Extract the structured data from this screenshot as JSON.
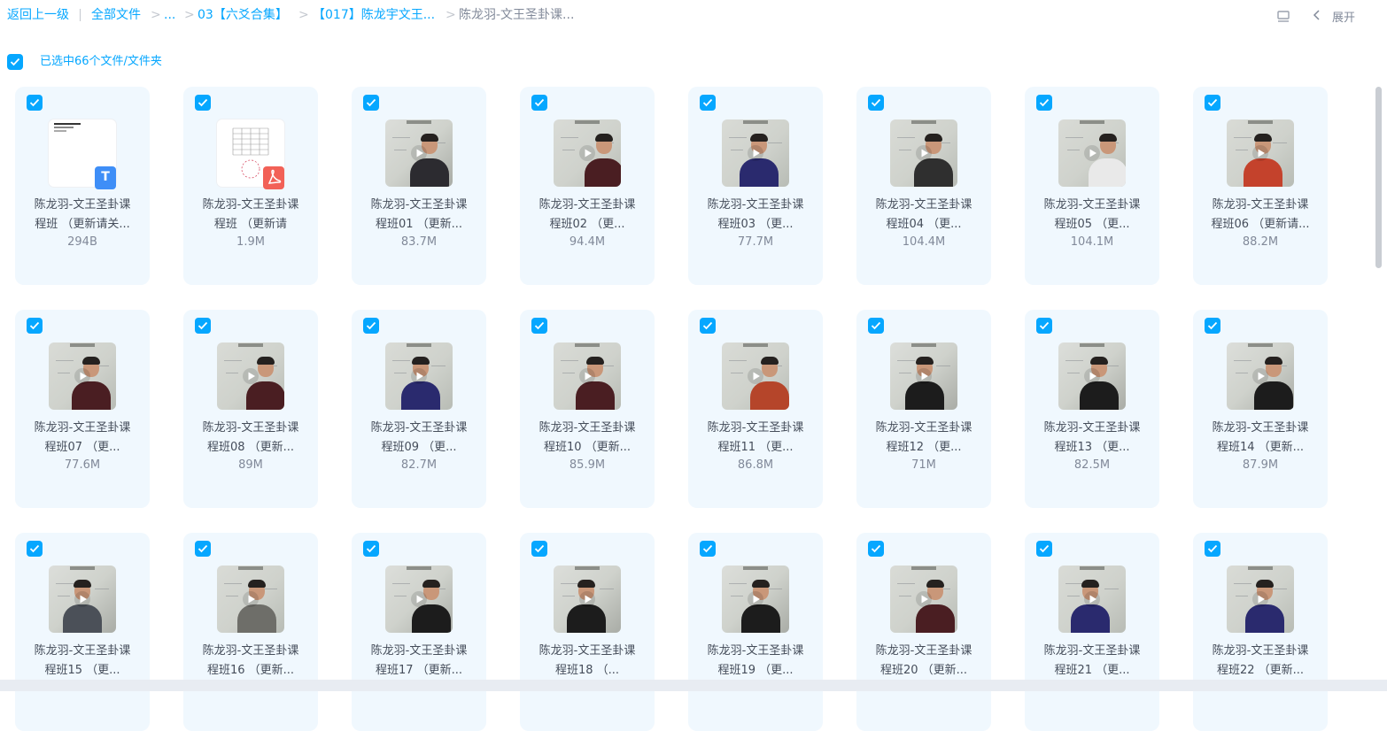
{
  "breadcrumb": {
    "back": "返回上一级",
    "all_files": "全部文件",
    "ellipsis": "...",
    "level1": "03【六爻合集】",
    "level2": "【017】陈龙宇文王...",
    "current": "陈龙羽-文王圣卦课..."
  },
  "toolbar": {
    "collapse_label": "展开"
  },
  "selection": {
    "label": "已选中66个文件/文件夹"
  },
  "colors": {
    "accent": "#06a7ff",
    "card_bg": "#f0f8fe",
    "text": "#454d5a",
    "muted": "#818999"
  },
  "files": [
    {
      "line1": "陈龙羽-文王圣卦课",
      "line2": "程班 （更新请关...",
      "size": "294B",
      "kind": "doc",
      "badge": "T"
    },
    {
      "line1": "陈龙羽-文王圣卦课",
      "line2": "程班 （更新请",
      "size": "1.9M",
      "kind": "pdf"
    },
    {
      "line1": "陈龙羽-文王圣卦课",
      "line2": "程班01 （更新...",
      "size": "83.7M",
      "kind": "video",
      "tone": "#2c2b30"
    },
    {
      "line1": "陈龙羽-文王圣卦课",
      "line2": "程班02 （更...",
      "size": "94.4M",
      "kind": "video",
      "tone": "#4a1e22"
    },
    {
      "line1": "陈龙羽-文王圣卦课",
      "line2": "程班03 （更...",
      "size": "77.7M",
      "kind": "video",
      "tone": "#2a2a6e"
    },
    {
      "line1": "陈龙羽-文王圣卦课",
      "line2": "程班04 （更...",
      "size": "104.4M",
      "kind": "video",
      "tone": "#2f2f2f"
    },
    {
      "line1": "陈龙羽-文王圣卦课",
      "line2": "程班05 （更...",
      "size": "104.1M",
      "kind": "video",
      "tone": "#e9e9e9"
    },
    {
      "line1": "陈龙羽-文王圣卦课",
      "line2": "程班06 （更新请...",
      "size": "88.2M",
      "kind": "video",
      "tone": "#c4422c"
    },
    {
      "line1": "陈龙羽-文王圣卦课",
      "line2": "程班07 （更...",
      "size": "77.6M",
      "kind": "video",
      "tone": "#4a1e22"
    },
    {
      "line1": "陈龙羽-文王圣卦课",
      "line2": "程班08 （更新...",
      "size": "89M",
      "kind": "video",
      "tone": "#4a1e22"
    },
    {
      "line1": "陈龙羽-文王圣卦课",
      "line2": "程班09 （更...",
      "size": "82.7M",
      "kind": "video",
      "tone": "#2a2a6e"
    },
    {
      "line1": "陈龙羽-文王圣卦课",
      "line2": "程班10 （更新...",
      "size": "85.9M",
      "kind": "video",
      "tone": "#4a1e22"
    },
    {
      "line1": "陈龙羽-文王圣卦课",
      "line2": "程班11 （更...",
      "size": "86.8M",
      "kind": "video",
      "tone": "#b5452a"
    },
    {
      "line1": "陈龙羽-文王圣卦课",
      "line2": "程班12 （更...",
      "size": "71M",
      "kind": "video",
      "tone": "#1c1c1c"
    },
    {
      "line1": "陈龙羽-文王圣卦课",
      "line2": "程班13 （更...",
      "size": "82.5M",
      "kind": "video",
      "tone": "#1c1c1c"
    },
    {
      "line1": "陈龙羽-文王圣卦课",
      "line2": "程班14 （更新...",
      "size": "87.9M",
      "kind": "video",
      "tone": "#1c1c1c"
    },
    {
      "line1": "陈龙羽-文王圣卦课",
      "line2": "程班15 （更...",
      "size": "",
      "kind": "video",
      "tone": "#4b5058"
    },
    {
      "line1": "陈龙羽-文王圣卦课",
      "line2": "程班16 （更新...",
      "size": "",
      "kind": "video",
      "tone": "#6e6e69"
    },
    {
      "line1": "陈龙羽-文王圣卦课",
      "line2": "程班17 （更新...",
      "size": "",
      "kind": "video",
      "tone": "#1c1c1c"
    },
    {
      "line1": "陈龙羽-文王圣卦课",
      "line2": "程班18 （...",
      "size": "",
      "kind": "video",
      "tone": "#1c1c1c"
    },
    {
      "line1": "陈龙羽-文王圣卦课",
      "line2": "程班19 （更...",
      "size": "",
      "kind": "video",
      "tone": "#1c1c1c"
    },
    {
      "line1": "陈龙羽-文王圣卦课",
      "line2": "程班20 （更新...",
      "size": "",
      "kind": "video",
      "tone": "#4a1e22"
    },
    {
      "line1": "陈龙羽-文王圣卦课",
      "line2": "程班21 （更...",
      "size": "",
      "kind": "video",
      "tone": "#2a2a6e"
    },
    {
      "line1": "陈龙羽-文王圣卦课",
      "line2": "程班22 （更新...",
      "size": "",
      "kind": "video",
      "tone": "#2a2a6e"
    }
  ]
}
